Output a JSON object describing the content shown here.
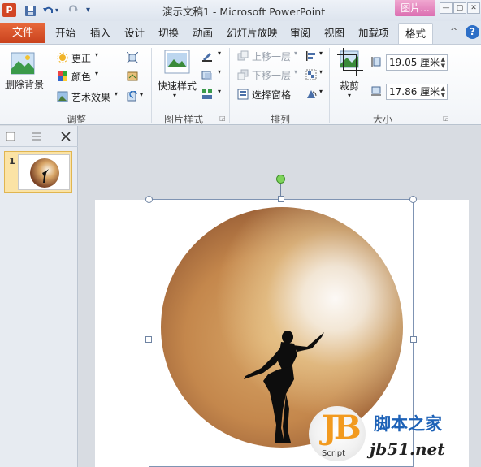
{
  "window": {
    "title": "演示文稿1 - Microsoft PowerPoint",
    "app_icon": "P",
    "context_tab_header": "图片...",
    "controls": [
      "—",
      "▢",
      "✕"
    ]
  },
  "quick_access": {
    "icons": [
      "save-icon",
      "undo-icon",
      "redo-icon",
      "customize-icon"
    ]
  },
  "tabs": {
    "file": "文件",
    "items": [
      "开始",
      "插入",
      "设计",
      "切换",
      "动画",
      "幻灯片放映",
      "审阅",
      "视图",
      "加载项"
    ],
    "active": "格式"
  },
  "ribbon": {
    "adjust": {
      "label": "调整",
      "remove_background": "删除背景",
      "corrections": "更正",
      "color": "颜色",
      "artistic_effects": "艺术效果"
    },
    "picture_styles": {
      "label": "图片样式",
      "quick_styles": "快速样式"
    },
    "arrange": {
      "label": "排列",
      "bring_forward": "上移一层",
      "send_backward": "下移一层",
      "selection_pane": "选择窗格"
    },
    "size": {
      "label": "大小",
      "crop": "裁剪",
      "height": "19.05 厘米",
      "width": "17.86 厘米"
    }
  },
  "slides_panel": {
    "slide_number": "1"
  },
  "watermark": {
    "logo_text": "JB",
    "logo_sub": "Script",
    "site_name": "脚本之家",
    "url": "jb51.net"
  },
  "colors": {
    "file_tab": "#d24625",
    "context_tab": "#dc6fb1",
    "selection": "#7f94b3",
    "rotate_handle": "#7dd35a"
  }
}
